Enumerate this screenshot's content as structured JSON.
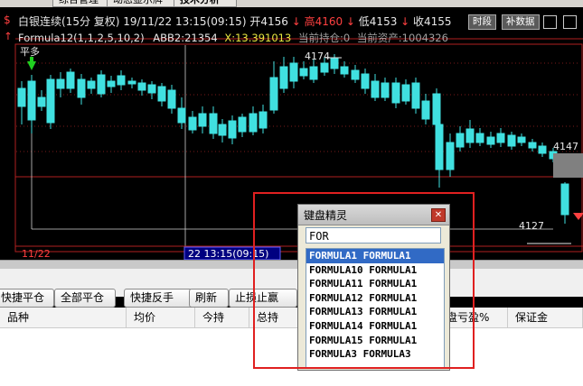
{
  "tabs": [
    "综合管理",
    "动态显示牌",
    "技术分析"
  ],
  "header": {
    "symbol_icon": "dollar-icon",
    "line1": [
      {
        "text": "白银连续(15分 复权) 19/11/22 13:15(09:15)",
        "color": "#e8e8e8"
      },
      {
        "text": "开4156",
        "color": "#e8e8e8"
      },
      {
        "text": "↓",
        "color": "#ff4040"
      },
      {
        "text": "高4160",
        "color": "#ff4040"
      },
      {
        "text": "↓",
        "color": "#ff4040"
      },
      {
        "text": "低4153",
        "color": "#e8e8e8"
      },
      {
        "text": "↓",
        "color": "#ff4040"
      },
      {
        "text": "收4155",
        "color": "#e8e8e8"
      }
    ],
    "line2_prefix": "Formula12(1,1,2,5,10,2)",
    "abb2": "ABB2:21354",
    "x_value": "X:13.391013",
    "position": "当前持仓:0",
    "assets": "当前资产:1004326"
  },
  "buttons_top": {
    "time": "时段",
    "data": "补数据"
  },
  "chart_labels": {
    "ping_duo": "平多",
    "high_price": "4174",
    "right_price": "4147",
    "low_price": "4127",
    "date_left": "11/22",
    "date_cursor": "22 13:15(09:15)"
  },
  "toolbar": {
    "buttons": [
      "快捷平仓",
      "全部平仓",
      "快捷反手",
      "刷新",
      "止损止赢"
    ]
  },
  "table": {
    "columns": [
      "品种",
      "均价",
      "今持",
      "总持",
      "盘亏盈%",
      "保证金"
    ]
  },
  "dialog": {
    "title": "键盘精灵",
    "input": "FOR",
    "items": [
      "FORMULA1 FORMULA1",
      "FORMULA10 FORMULA1",
      "FORMULA11 FORMULA1",
      "FORMULA12 FORMULA1",
      "FORMULA13 FORMULA1",
      "FORMULA14 FORMULA1",
      "FORMULA15 FORMULA1",
      "FORMULA3 FORMULA3"
    ],
    "selected_index": 0
  },
  "colors": {
    "up": "#ff4040",
    "down": "#40e0e0",
    "highlight": "#e02020"
  }
}
